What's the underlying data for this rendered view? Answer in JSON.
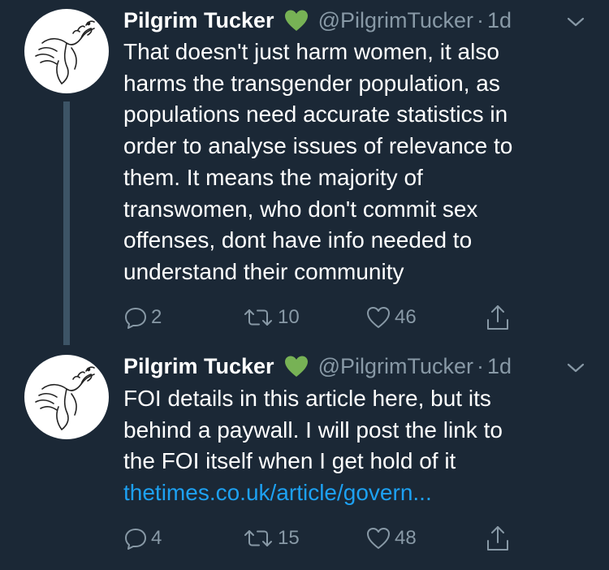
{
  "tweets": [
    {
      "author_name": "Pilgrim Tucker",
      "author_emoji": "green-heart",
      "handle": "@PilgrimTucker",
      "separator": "·",
      "time": "1d",
      "text_lines": [
        "That doesn't just harm women, it also",
        "harms the transgender population, as",
        "populations need accurate statistics in",
        "order to analyse issues of relevance to",
        "them. It means the majority of",
        "transwomen, who don't commit sex",
        "offenses, dont have info needed to",
        "understand their community"
      ],
      "link": "",
      "replies": "2",
      "retweets": "10",
      "likes": "46"
    },
    {
      "author_name": "Pilgrim Tucker",
      "author_emoji": "green-heart",
      "handle": "@PilgrimTucker",
      "separator": "·",
      "time": "1d",
      "text_lines": [
        "FOI details in this article here, but its",
        "behind a paywall. I will post the link to",
        "the FOI itself when I get hold of it"
      ],
      "link": "thetimes.co.uk/article/govern...",
      "replies": "4",
      "retweets": "15",
      "likes": "48"
    }
  ],
  "colors": {
    "background": "#1b2836",
    "text": "#ffffff",
    "muted": "#8899a6",
    "link": "#1da1f2",
    "thread_line": "#3d5466",
    "emoji_heart": "#77b255"
  },
  "icons": {
    "avatar": "dove-with-olive-branch",
    "reply": "reply-bubble-icon",
    "retweet": "retweet-icon",
    "like": "heart-outline-icon",
    "share": "share-upload-icon",
    "menu": "chevron-down-icon"
  }
}
